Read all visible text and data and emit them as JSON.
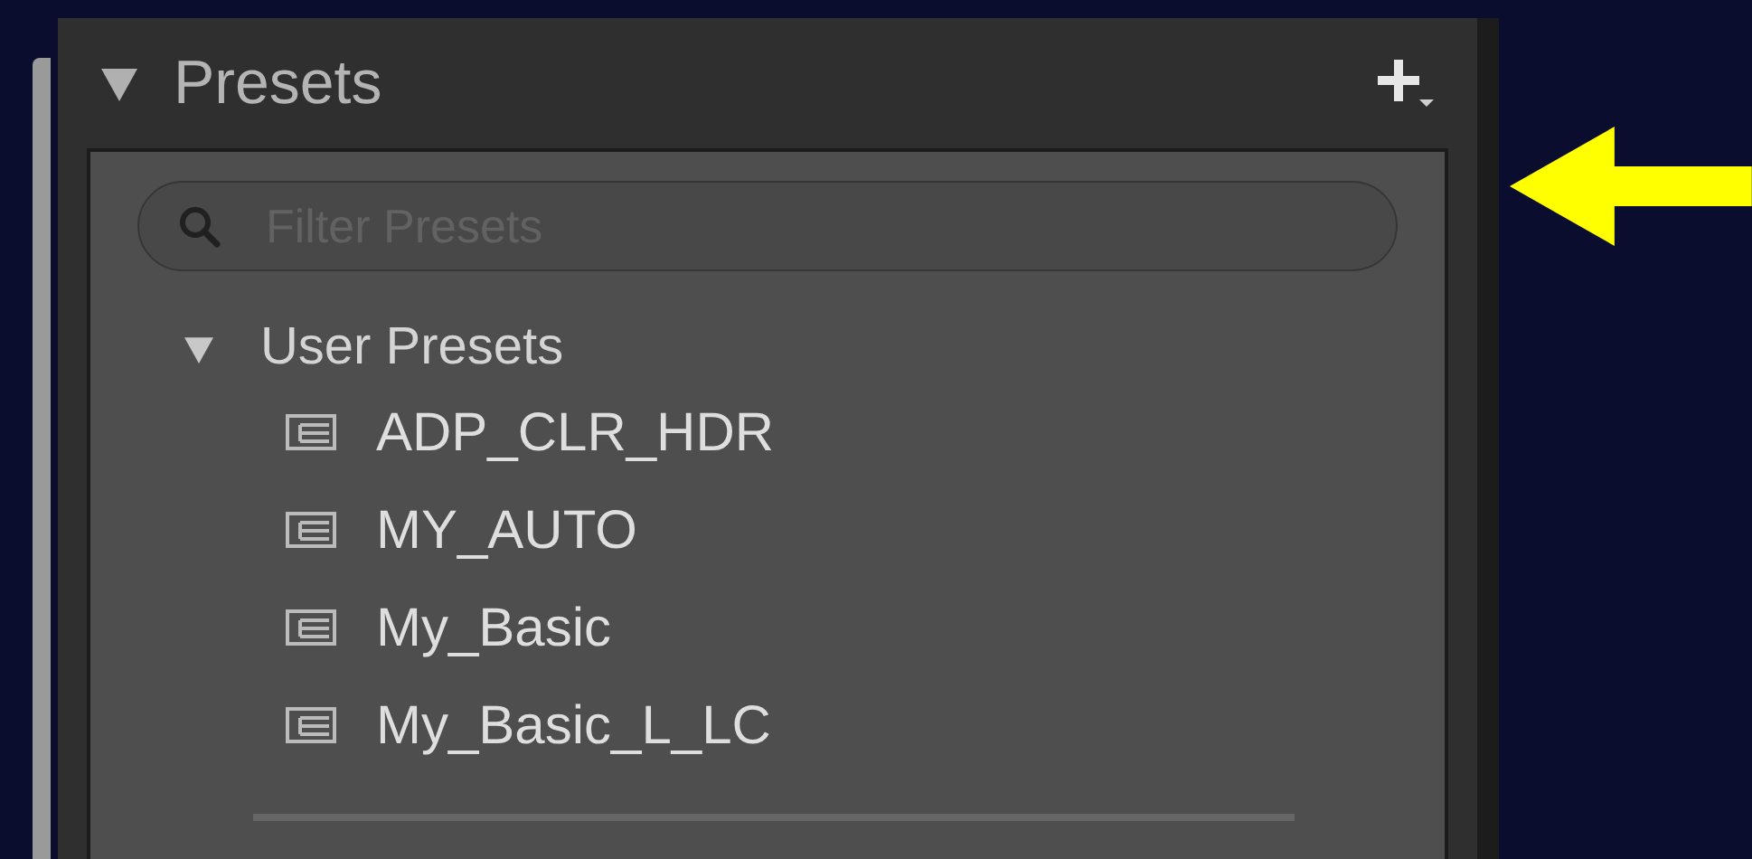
{
  "panel": {
    "title": "Presets",
    "expanded": true
  },
  "search": {
    "placeholder": "Filter Presets"
  },
  "folders": [
    {
      "label": "User Presets",
      "expanded": true,
      "children": [
        {
          "label": "ADP_CLR_HDR"
        },
        {
          "label": "MY_AUTO"
        },
        {
          "label": "My_Basic"
        },
        {
          "label": "My_Basic_L_LC"
        }
      ]
    }
  ]
}
